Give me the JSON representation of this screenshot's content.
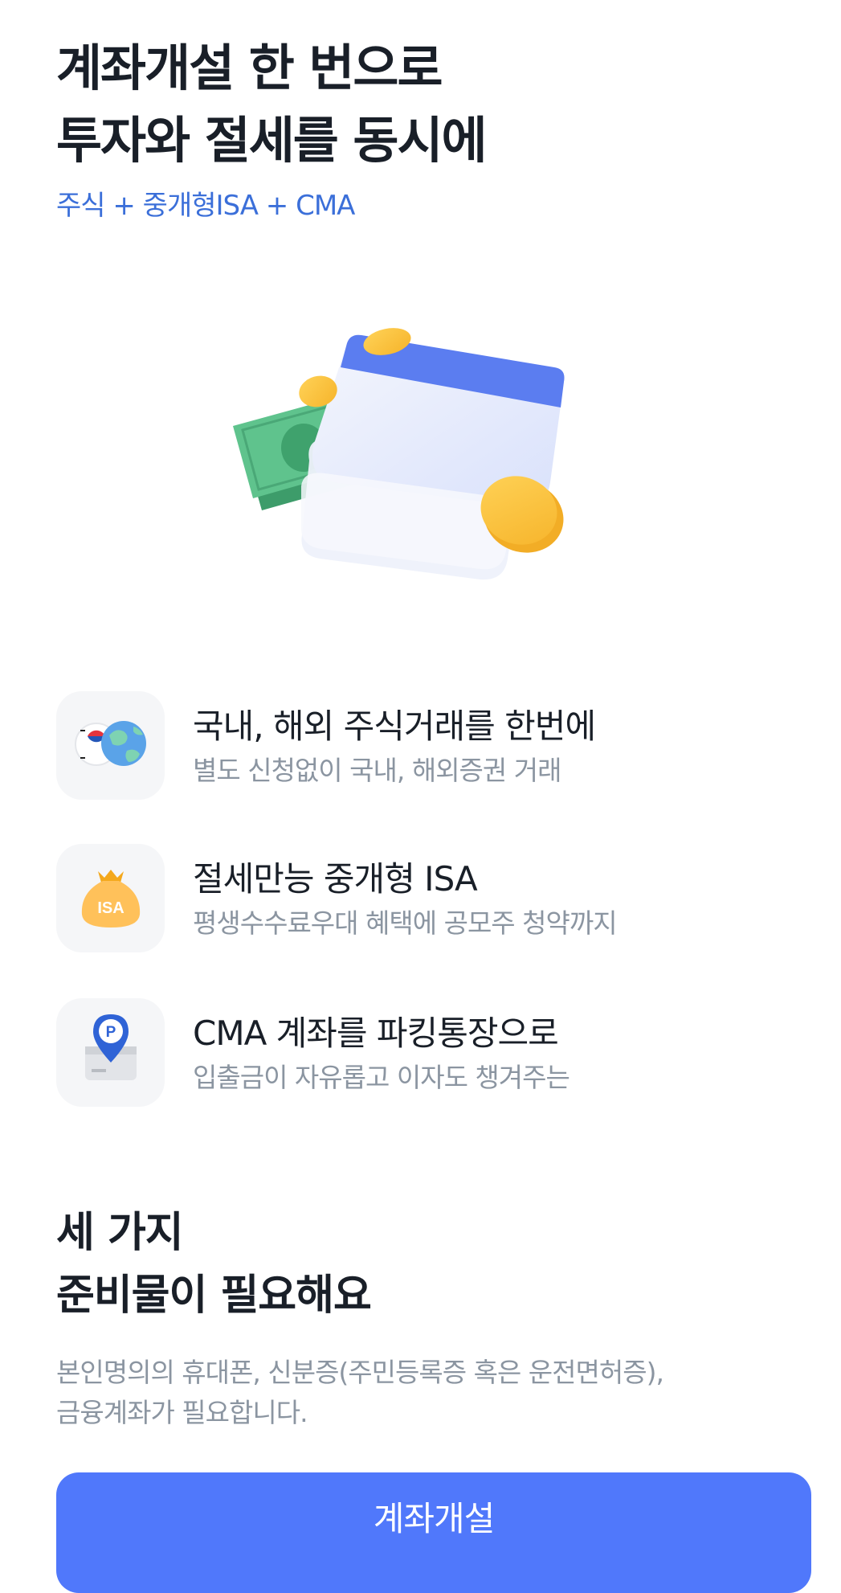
{
  "hero": {
    "title_line1": "계좌개설 한 번으로",
    "title_line2": "투자와 절세를 동시에",
    "subtitle": "주식 + 중개형ISA + CMA"
  },
  "features": [
    {
      "title": "국내, 해외 주식거래를 한번에",
      "desc": "별도 신청없이 국내, 해외증권 거래",
      "icon": "globe-flag-icon"
    },
    {
      "title": "절세만능 중개형 ISA",
      "desc": "평생수수료우대 혜택에 공모주 청약까지",
      "icon": "isa-money-bag-icon",
      "icon_label": "ISA"
    },
    {
      "title": "CMA 계좌를 파킹통장으로",
      "desc": "입출금이 자유롭고 이자도 챙겨주는",
      "icon": "parking-pin-icon",
      "icon_label": "P"
    }
  ],
  "requirements": {
    "title_line1": "세 가지",
    "title_line2": "준비물이 필요해요",
    "desc_line1": "본인명의의 휴대폰, 신분증(주민등록증 혹은 운전면허증),",
    "desc_line2": "금융계좌가 필요합니다."
  },
  "cta": {
    "label": "계좌개설"
  },
  "colors": {
    "accent": "#5078fb",
    "subtitle": "#3b6fd9",
    "muted": "#8b95a1",
    "text": "#191f28"
  }
}
